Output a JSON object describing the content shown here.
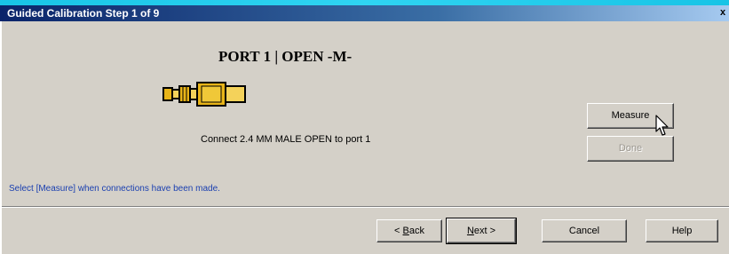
{
  "window": {
    "title": "Guided Calibration Step 1 of 9",
    "close_glyph": "x"
  },
  "step": {
    "heading": "PORT 1 | OPEN -M-",
    "instruction": "Connect 2.4 MM MALE OPEN to port 1",
    "hint": "Select [Measure] when connections have been made."
  },
  "side_buttons": {
    "measure": "Measure",
    "done": "Done",
    "done_enabled": false
  },
  "nav": {
    "back_mnemonic": "B",
    "back_rest": "ack",
    "back_prefix": "< ",
    "next_mnemonic": "N",
    "next_rest": "ext",
    "next_suffix": " >",
    "cancel": "Cancel",
    "help": "Help"
  },
  "icons": {
    "connector": "connector-icon",
    "cursor": "mouse-cursor-icon"
  },
  "colors": {
    "title_bar": "#0a246a",
    "hint_text": "#1a3fb0",
    "dialog_bg": "#d4d0c8",
    "connector_gold": "#e8b418"
  }
}
